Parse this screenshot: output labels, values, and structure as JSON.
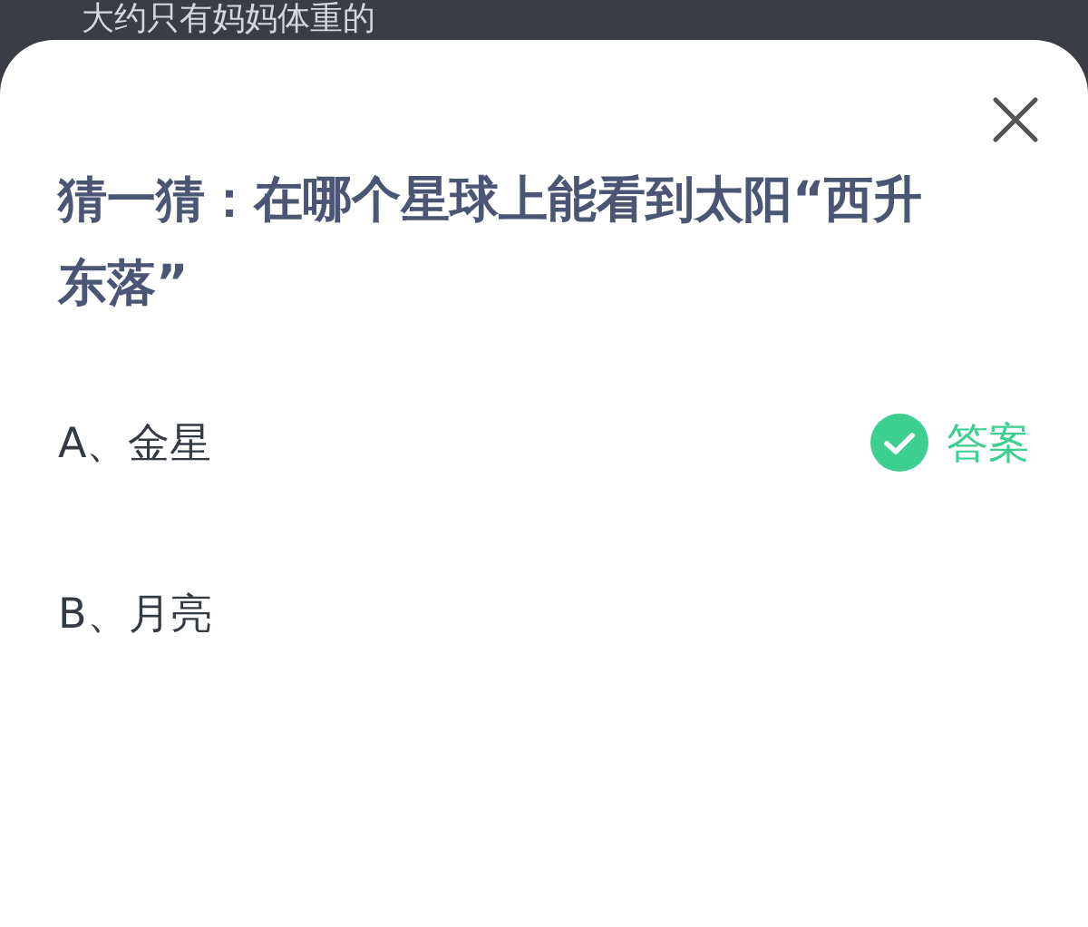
{
  "background_text": "大约只有妈妈体重的",
  "question": "猜一猜：在哪个星球上能看到太阳“西升东落”",
  "answer_label": "答案",
  "options": [
    {
      "label": "A、金星",
      "correct": true
    },
    {
      "label": "B、月亮",
      "correct": false
    }
  ]
}
